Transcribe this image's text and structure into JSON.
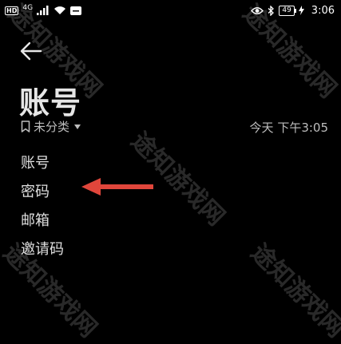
{
  "status_bar": {
    "hd_badge": "HD",
    "signal_label": "4G",
    "battery_level": "49",
    "time": "3:06"
  },
  "note": {
    "title": "账号",
    "category": "未分类",
    "timestamp": "今天 下午3:05",
    "lines": [
      "账号",
      "密码",
      "邮箱",
      "邀请码"
    ]
  },
  "watermark": {
    "text": "途知游戏网"
  },
  "colors": {
    "background": "#000000",
    "annotation_arrow": "#e0463b"
  },
  "icons": {
    "back": "back-arrow-icon",
    "bookmark": "bookmark-icon",
    "eye": "eye-icon",
    "bluetooth": "bluetooth-icon",
    "wifi": "wifi-icon",
    "signal": "signal-bars-icon"
  }
}
